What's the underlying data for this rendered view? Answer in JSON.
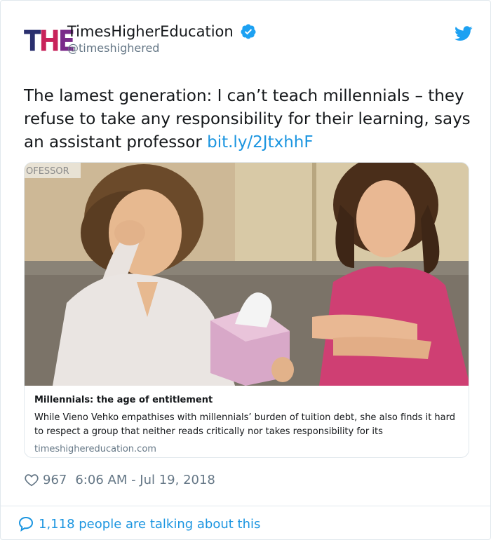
{
  "account": {
    "logo_text": [
      "T",
      "H",
      "E"
    ],
    "display_name": "TimesHigherEducation",
    "handle": "@timeshighered",
    "avatar_icon": "the-logo",
    "verified_icon": "verified-badge-icon",
    "platform_icon": "twitter-bird-icon"
  },
  "tweet": {
    "text": "The lamest generation: I can’t teach millennials – they refuse to take any responsibility for their learning, says an assistant professor ",
    "link_text": "bit.ly/2JtxhhF"
  },
  "card": {
    "image_caption_text": "OFESSOR",
    "title": "Millennials: the age of entitlement",
    "description": "While Vieno Vehko empathises with millennials’ burden of tuition debt, she also finds it hard to respect a group that neither reads critically nor takes responsibility for its",
    "domain": "timeshighereducation.com"
  },
  "meta": {
    "likes": "967",
    "timestamp": "6:06 AM - Jul 19, 2018",
    "heart_icon": "heart-icon"
  },
  "footer": {
    "talking": "1,118 people are talking about this",
    "reply_icon": "speech-bubble-icon"
  },
  "colors": {
    "link_blue": "#1b95e0",
    "muted_gray": "#657786",
    "border": "#e1e8ed"
  }
}
